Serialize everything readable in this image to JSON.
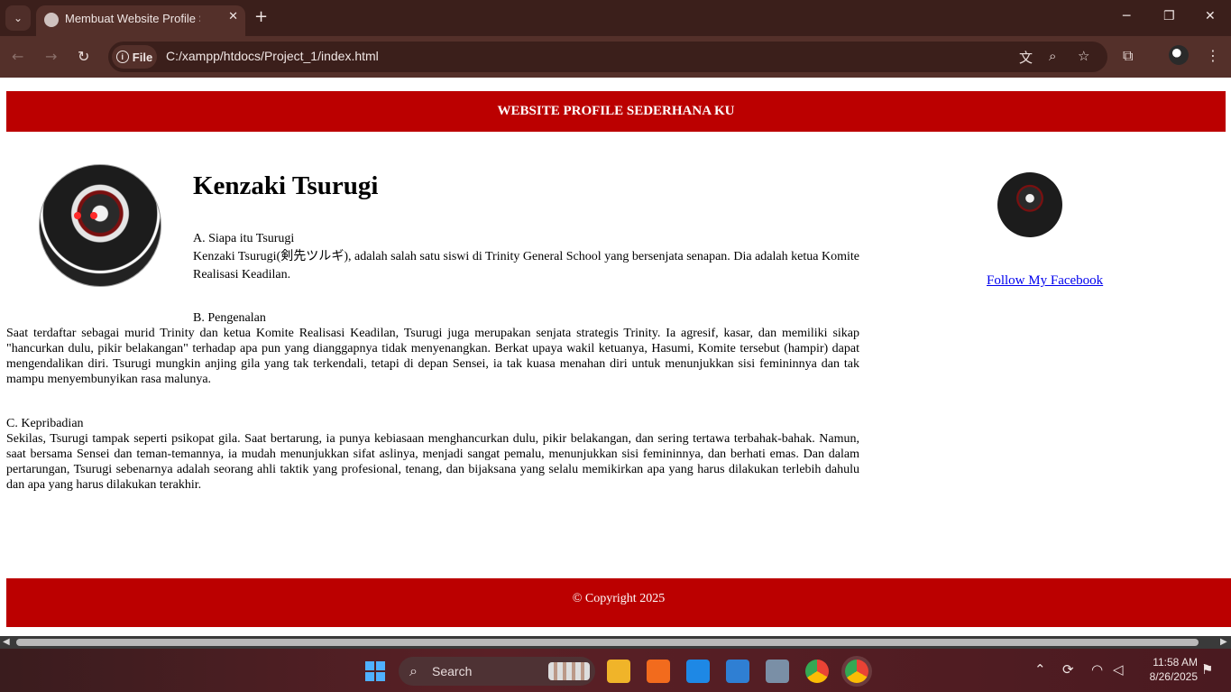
{
  "browser": {
    "tab_title": "Membuat Website Profile Sederhana",
    "url": "C:/xampp/htdocs/Project_1/index.html",
    "file_chip": "File",
    "icons": {
      "tab_menu": "chevron-down-icon",
      "close_tab": "close-icon",
      "new_tab": "plus-icon",
      "back": "arrow-left-icon",
      "forward": "arrow-right-icon",
      "reload": "reload-icon",
      "translate": "translate-icon",
      "zoom": "zoom-icon",
      "bookmark": "star-icon",
      "extensions": "puzzle-icon",
      "menu": "kebab-menu-icon"
    }
  },
  "page": {
    "header": "WEBSITE PROFILE SEDERHANA KU",
    "name": "Kenzaki Tsurugi",
    "sections": [
      {
        "title": "A. Siapa itu Tsurugi",
        "body": "Kenzaki Tsurugi(剣先ツルギ), adalah salah satu siswi di Trinity General School yang bersenjata senapan. Dia adalah ketua Komite Realisasi Keadilan."
      },
      {
        "title": "B. Pengenalan",
        "body": "Saat terdaftar sebagai murid Trinity dan ketua Komite Realisasi Keadilan, Tsurugi juga merupakan senjata strategis Trinity. Ia agresif, kasar, dan memiliki sikap \"hancurkan dulu, pikir belakangan\" terhadap apa pun yang dianggapnya tidak menyenangkan. Berkat upaya wakil ketuanya, Hasumi, Komite tersebut (hampir) dapat mengendalikan diri. Tsurugi mungkin anjing gila yang tak terkendali, tetapi di depan Sensei, ia tak kuasa menahan diri untuk menunjukkan sisi femininnya dan tak mampu menyembunyikan rasa malunya."
      },
      {
        "title": "C. Kepribadian",
        "body": "Sekilas, Tsurugi tampak seperti psikopat gila. Saat bertarung, ia punya kebiasaan menghancurkan dulu, pikir belakangan, dan sering tertawa terbahak-bahak. Namun, saat bersama Sensei dan teman-temannya, ia mudah menunjukkan sifat aslinya, menjadi sangat pemalu, menunjukkan sisi femininnya, dan berhati emas. Dan dalam pertarungan, Tsurugi sebenarnya adalah seorang ahli taktik yang profesional, tenang, dan bijaksana yang selalu memikirkan apa yang harus dilakukan terlebih dahulu dan apa yang harus dilakukan terakhir."
      }
    ],
    "facebook_link": "Follow My Facebook",
    "footer": "© Copyright 2025",
    "accent_color": "#bb0000"
  },
  "taskbar": {
    "search_placeholder": "Search",
    "time": "11:58 AM",
    "date": "8/26/2025"
  }
}
